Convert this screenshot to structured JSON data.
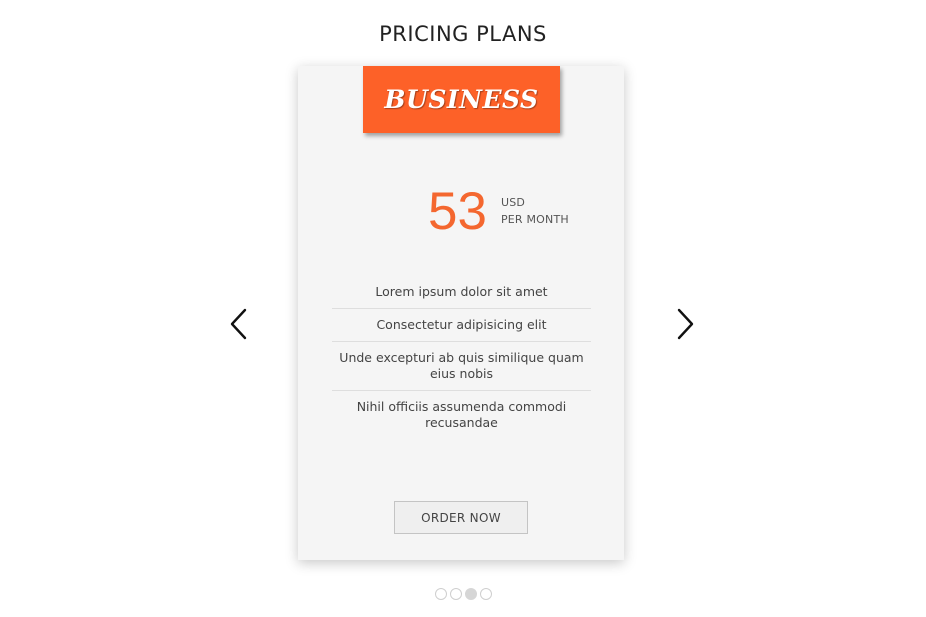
{
  "page": {
    "title": "PRICING PLANS"
  },
  "carousel": {
    "prev_icon": "chevron-left-icon",
    "next_icon": "chevron-right-icon",
    "slide_count": 4,
    "active_slide": 3
  },
  "card": {
    "plan_name": "BUSINESS",
    "price": "53",
    "currency": "USD",
    "period": "PER MONTH",
    "features": [
      "Lorem ipsum dolor sit amet",
      "Consectetur adipisicing elit",
      "Unde excepturi ab quis similique quam eius nobis",
      "Nihil officiis assumenda commodi recusandae"
    ],
    "order_label": "ORDER NOW"
  },
  "colors": {
    "accent": "#fd6128",
    "price": "#f4672f",
    "card_bg": "#f5f5f5"
  }
}
